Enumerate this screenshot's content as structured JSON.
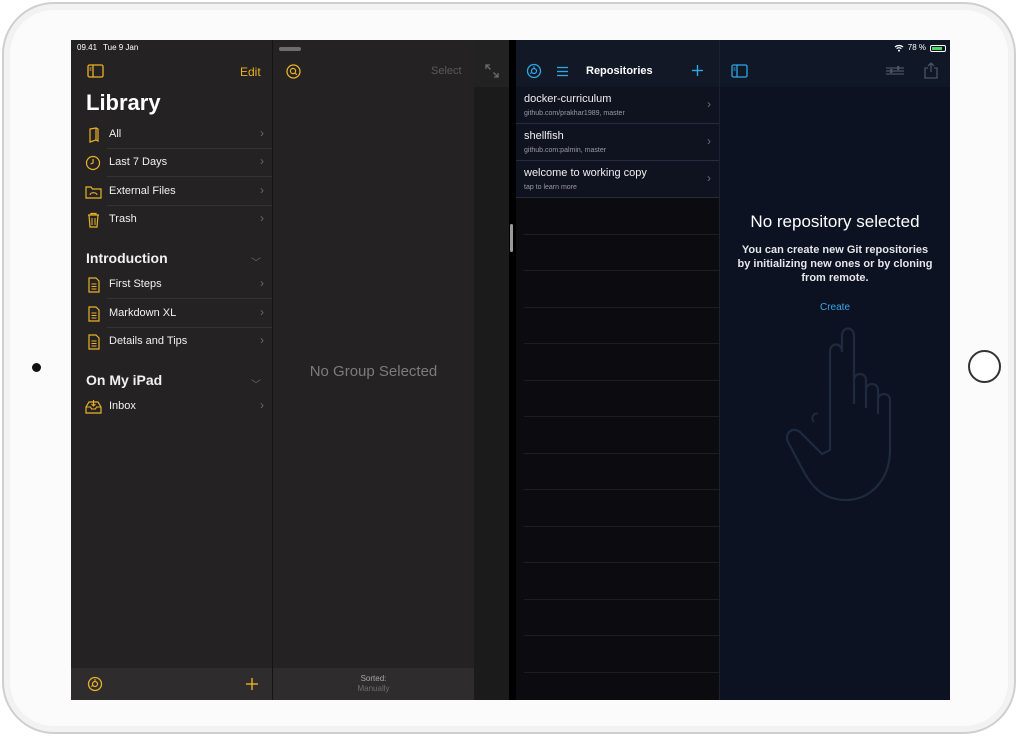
{
  "status_bar": {
    "time": "09.41",
    "date": "Tue 9 Jan",
    "battery": "78 %"
  },
  "ulysses": {
    "library": {
      "edit_label": "Edit",
      "title": "Library",
      "items": [
        {
          "label": "All",
          "icon": "book-icon"
        },
        {
          "label": "Last 7 Days",
          "icon": "clock-icon"
        },
        {
          "label": "External Files",
          "icon": "folder-icon"
        },
        {
          "label": "Trash",
          "icon": "trash-icon"
        }
      ],
      "sections": [
        {
          "title": "Introduction",
          "items": [
            {
              "label": "First Steps",
              "icon": "document-icon"
            },
            {
              "label": "Markdown XL",
              "icon": "document-icon"
            },
            {
              "label": "Details and Tips",
              "icon": "document-icon"
            }
          ]
        },
        {
          "title": "On My iPad",
          "items": [
            {
              "label": "Inbox",
              "icon": "inbox-icon"
            }
          ]
        }
      ]
    },
    "group": {
      "select_label": "Select",
      "empty_text": "No Group Selected",
      "sorted_label": "Sorted:",
      "sorted_value": "Manually"
    },
    "accent_color": "#e9b227"
  },
  "working_copy": {
    "title": "Repositories",
    "repos": [
      {
        "name": "docker-curriculum",
        "detail": "github.com/prakhar1989, master"
      },
      {
        "name": "shellfish",
        "detail": "github.com:palmin, master"
      },
      {
        "name": "welcome to working copy",
        "detail": "tap to learn more"
      }
    ],
    "detail": {
      "title": "No repository selected",
      "description": "You can create new Git repositories by initializing new ones or by cloning from remote.",
      "create_label": "Create"
    },
    "accent_color": "#2fa7e6"
  }
}
